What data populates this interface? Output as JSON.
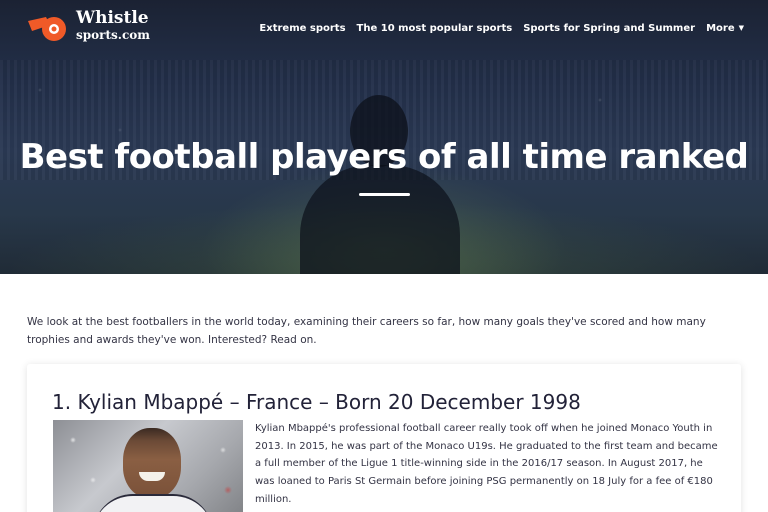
{
  "header": {
    "logo": {
      "line1": "Whistle",
      "line2": "sports.com",
      "accent": "#f05a28"
    },
    "nav": [
      {
        "label": "Extreme sports"
      },
      {
        "label": "The 10 most popular sports"
      },
      {
        "label": "Sports for Spring and Summer"
      },
      {
        "label": "More",
        "icon": "caret-down-icon"
      }
    ]
  },
  "hero": {
    "title": "Best football players of all time ranked"
  },
  "intro": {
    "text": "We look at the best footballers in the world today, examining their careers so far, how many goals they've scored and how many trophies and awards they've won. Interested? Read on."
  },
  "article": {
    "title": "1. Kylian Mbappé – France – Born 20 December 1998",
    "body": "Kylian Mbappé's professional football career really took off when he joined Monaco Youth in 2013. In 2015, he was part of the Monaco U19s. He graduated to the first team and became a full member of the Ligue 1 title-winning side in the 2016/17 season. In August 2017, he was loaned to Paris St Germain before joining PSG permanently on 18 July for a fee of €180 million."
  },
  "colors": {
    "hero_dark": "#1b2233",
    "text": "#333344",
    "title": "#222238",
    "white": "#ffffff"
  }
}
